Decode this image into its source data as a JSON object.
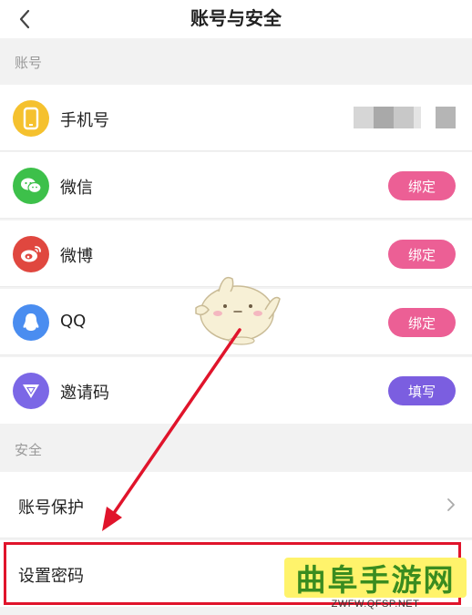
{
  "header": {
    "title": "账号与安全",
    "back_icon": "chevron-left-icon"
  },
  "sections": {
    "account": {
      "label": "账号"
    },
    "security": {
      "label": "安全"
    }
  },
  "account_rows": [
    {
      "label": "手机号",
      "icon": "phone-icon",
      "icon_color": "#f5c12e",
      "value_masked": true
    },
    {
      "label": "微信",
      "icon": "wechat-icon",
      "icon_color": "#3dc04a",
      "action": "绑定",
      "action_color": "#ec5f95"
    },
    {
      "label": "微博",
      "icon": "weibo-icon",
      "icon_color": "#e0473f",
      "action": "绑定",
      "action_color": "#ec5f95"
    },
    {
      "label": "QQ",
      "icon": "qq-icon",
      "icon_color": "#4a8df0",
      "action": "绑定",
      "action_color": "#ec5f95"
    },
    {
      "label": "邀请码",
      "icon": "invite-code-icon",
      "icon_color": "#7b67e6",
      "action": "填写",
      "action_color": "#7b5ee0"
    }
  ],
  "security_rows": [
    {
      "label": "账号保护",
      "has_chevron": true
    },
    {
      "label": "设置密码"
    }
  ],
  "watermark": {
    "main": "曲阜手游网",
    "sub": "ZWFW.QFSP.NET"
  },
  "annotation_color": "#e0142b"
}
